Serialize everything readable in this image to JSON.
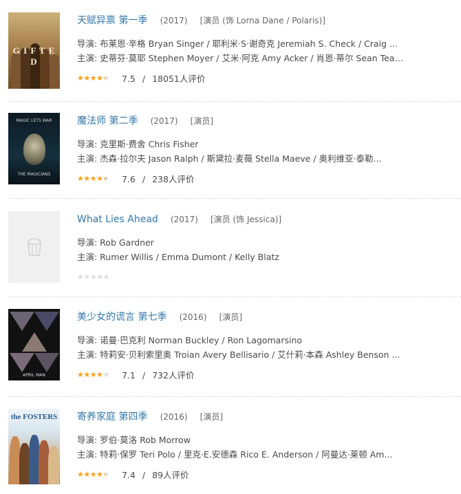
{
  "items": [
    {
      "title": "天赋异禀 第一季",
      "year": "(2017)",
      "role": "[演员 (饰 Lorna Dane / Polaris)]",
      "director": "导演: 布莱恩·辛格 Bryan Singer / 耶利米·S·谢奇克 Jeremiah S. Check / Craig ...",
      "cast": "主演: 史蒂芬·莫耶 Stephen Moyer / 艾米·阿克 Amy Acker / 肖恩·蒂尔 Sean Teal...",
      "rating": 3.75,
      "score": "7.5",
      "votes": "18051人评价",
      "poster_text": "G I F T E D"
    },
    {
      "title": "魔法师 第二季",
      "year": "(2017)",
      "role": "[演员]",
      "director": "导演: 克里斯·费舍 Chris Fisher",
      "cast": "主演: 杰森·拉尔夫 Jason Ralph / 斯黛拉·麦薇 Stella Maeve / 奥利维亚·泰勒...",
      "rating": 3.8,
      "score": "7.6",
      "votes": "238人评价",
      "poster_text_top": "MAGIC LETS WAR",
      "poster_text_bottom": "THE MAGICIANS"
    },
    {
      "title": "What Lies Ahead",
      "year": "(2017)",
      "role": "[演员 (饰 Jessica)]",
      "director": "导演: Rob Gardner",
      "cast": "主演: Rumer Willis / Emma Dumont / Kelly Blatz",
      "rating": 0
    },
    {
      "title": "美少女的谎言 第七季",
      "year": "(2016)",
      "role": "[演员]",
      "director": "导演: 诺曼·巴克利 Norman Buckley / Ron Lagomarsino",
      "cast": "主演: 特莉安·贝利索里奥 Troian Avery Bellisario / 艾什莉·本森 Ashley Benson ...",
      "rating": 3.55,
      "score": "7.1",
      "votes": "732人评价",
      "poster_text": "APRIL MAN"
    },
    {
      "title": "寄养家庭 第四季",
      "year": "(2016)",
      "role": "[演员]",
      "director": "导演: 罗伯·莫洛 Rob Morrow",
      "cast": "主演: 特莉·保罗 Teri Polo / 里克·E.安德森 Rico E. Anderson / 阿曼达·莱顿 Am...",
      "rating": 3.7,
      "score": "7.4",
      "votes": "89人评价",
      "poster_text": "the FOSTERS"
    }
  ],
  "rating_scale_max": 5,
  "colors": {
    "title_link": "#3377aa",
    "star": "#f4a31b",
    "star_empty": "#dddddd"
  },
  "separator": "/"
}
